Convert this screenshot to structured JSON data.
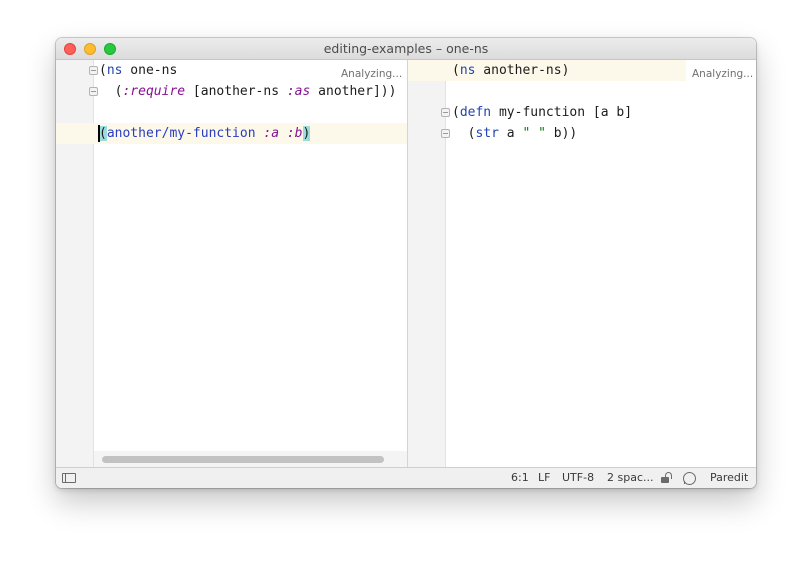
{
  "window": {
    "title": "editing-examples – one-ns"
  },
  "left_editor": {
    "status": "Analyzing...",
    "lines": {
      "l1": {
        "open": "(",
        "kw": "ns",
        "rest": " one-ns"
      },
      "l2": {
        "open": "  (",
        "key": ":require",
        "mid": " [another-ns ",
        "key2": ":as",
        "rest": " another]))"
      },
      "l4": {
        "open": "(",
        "fn": "another/my-function",
        "sp1": " ",
        "key1": ":a",
        "sp2": " ",
        "key2": ":b",
        "close": ")"
      }
    }
  },
  "right_editor": {
    "status": "Analyzing...",
    "lines": {
      "l1": {
        "open": "(",
        "kw": "ns",
        "rest": " another-ns)"
      },
      "l3": {
        "open": "(",
        "kw": "defn",
        "rest": " my-function [a b]"
      },
      "l4": {
        "open": "  (",
        "kw": "str",
        "mid": " a ",
        "s1": "\" \"",
        "rest": " b))"
      }
    }
  },
  "statusbar": {
    "position": "6:1",
    "line_ending": "LF",
    "encoding": "UTF-8",
    "indent": "2 spac...",
    "mode": "Paredit"
  },
  "colors": {
    "keyword": "#2243b4",
    "keyword_arg": "#871094",
    "string": "#0b7a0b",
    "brace_match": "#9cdcdc",
    "current_line": "#fcf9ea"
  },
  "icons": [
    "panel-toggle-icon",
    "lock-icon",
    "inspect-icon",
    "fold-icon"
  ]
}
